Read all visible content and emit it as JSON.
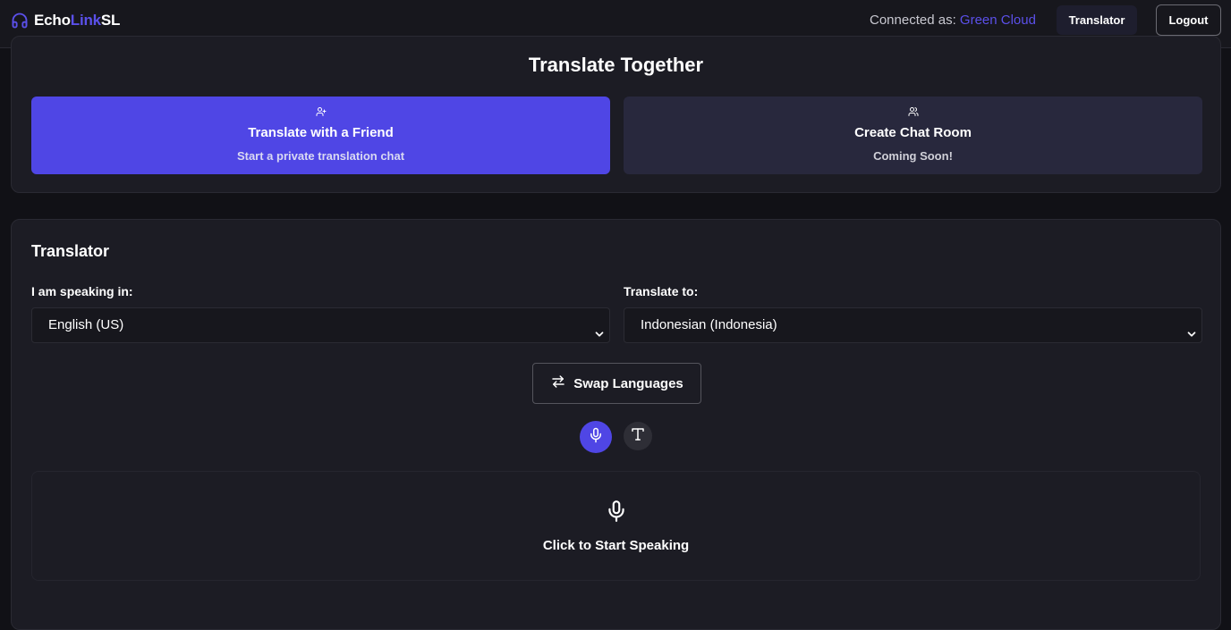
{
  "header": {
    "brand": {
      "part1": "Echo",
      "part2": "Link",
      "part3": "SL",
      "icon": "headphones-icon"
    },
    "connected_label": "Connected as:",
    "connected_user": "Green Cloud",
    "translator_button": "Translator",
    "logout_button": "Logout"
  },
  "together": {
    "title": "Translate Together",
    "options": [
      {
        "title": "Translate with a Friend",
        "subtitle": "Start a private translation chat",
        "icon": "user-plus-icon"
      },
      {
        "title": "Create Chat Room",
        "subtitle": "Coming Soon!",
        "icon": "users-icon"
      }
    ]
  },
  "translator": {
    "title": "Translator",
    "from_label": "I am speaking in:",
    "from_value": "English (US)",
    "to_label": "Translate to:",
    "to_value": "Indonesian (Indonesia)",
    "swap_label": "Swap Languages",
    "modes": [
      {
        "name": "voice",
        "icon": "microphone-icon",
        "active": true
      },
      {
        "name": "text",
        "icon": "text-icon",
        "active": false
      }
    ],
    "speak_prompt": "Click to Start Speaking"
  },
  "colors": {
    "accent": "#4f46e5",
    "brand_link": "#5b50ea",
    "background": "#111116",
    "card": "#1c1c24",
    "secondary_option": "#28283d"
  }
}
